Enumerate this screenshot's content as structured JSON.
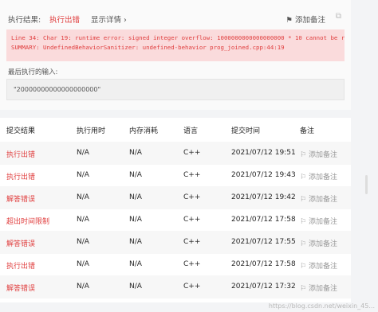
{
  "result_panel": {
    "label": "执行结果:",
    "status": "执行出错",
    "detail_link": "显示详情 ›",
    "add_note": "添加备注",
    "error_lines": [
      "Line 34: Char 19: runtime error: signed integer overflow: 1000000000000000000 * 10 cannot be re",
      "SUMMARY: UndefinedBehaviorSanitizer: undefined-behavior prog_joined.cpp:44:19"
    ],
    "last_input_label": "最后执行的输入:",
    "last_input_value": "\"20000000000000000000\""
  },
  "table": {
    "headers": [
      "提交结果",
      "执行用时",
      "内存消耗",
      "语言",
      "提交时间",
      "备注"
    ],
    "rows": [
      {
        "result": "执行出错",
        "time": "N/A",
        "memory": "N/A",
        "lang": "C++",
        "submitted": "2021/07/12 19:51",
        "note": "添加备注"
      },
      {
        "result": "执行出错",
        "time": "N/A",
        "memory": "N/A",
        "lang": "C++",
        "submitted": "2021/07/12 19:43",
        "note": "添加备注"
      },
      {
        "result": "解答错误",
        "time": "N/A",
        "memory": "N/A",
        "lang": "C++",
        "submitted": "2021/07/12 19:42",
        "note": "添加备注"
      },
      {
        "result": "超出时间限制",
        "time": "N/A",
        "memory": "N/A",
        "lang": "C++",
        "submitted": "2021/07/12 17:58",
        "note": "添加备注"
      },
      {
        "result": "解答错误",
        "time": "N/A",
        "memory": "N/A",
        "lang": "C++",
        "submitted": "2021/07/12 17:55",
        "note": "添加备注"
      },
      {
        "result": "执行出错",
        "time": "N/A",
        "memory": "N/A",
        "lang": "C++",
        "submitted": "2021/07/12 17:58",
        "note": "添加备注"
      },
      {
        "result": "解答错误",
        "time": "N/A",
        "memory": "N/A",
        "lang": "C++",
        "submitted": "2021/07/12 17:32",
        "note": "添加备注"
      }
    ]
  },
  "watermark": "https://blog.csdn.net/weixin_45..."
}
